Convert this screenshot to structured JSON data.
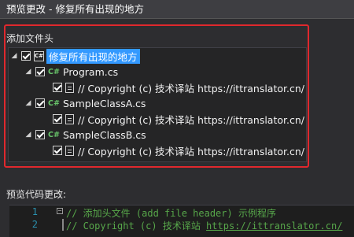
{
  "window": {
    "title": "预览更改 - 修复所有出现的地方"
  },
  "tree": {
    "header": "添加文件头",
    "root": {
      "label": "修复所有出现的地方",
      "checked": true,
      "icon": "csharp-project-icon"
    },
    "files": [
      {
        "label": "Program.cs",
        "checked": true,
        "icon": "csharp-file-icon",
        "child": {
          "label": "//  Copyright (c) 技术译站 https://ittranslator.cn/",
          "checked": true,
          "icon": "document-icon"
        }
      },
      {
        "label": "SampleClassA.cs",
        "checked": true,
        "icon": "csharp-file-icon",
        "child": {
          "label": "//  Copyright (c) 技术译站 https://ittranslator.cn/",
          "checked": true,
          "icon": "document-icon"
        }
      },
      {
        "label": "SampleClassB.cs",
        "checked": true,
        "icon": "csharp-file-icon",
        "child": {
          "label": "//  Copyright (c) 技术译站 https://ittranslator.cn/",
          "checked": true,
          "icon": "document-icon"
        }
      }
    ]
  },
  "preview": {
    "header": "预览代码更改:",
    "lines": [
      {
        "number": "1",
        "text": "// 添加头文件 (add file header) 示例程序"
      },
      {
        "number": "2",
        "prefix": "//  Copyright (c) 技术译站 ",
        "link": "https://ittranslator.cn/"
      }
    ]
  },
  "colors": {
    "accent": "#3399ff",
    "highlight_border": "#e0282d",
    "comment": "#57a64a",
    "line_number": "#2b91af"
  }
}
